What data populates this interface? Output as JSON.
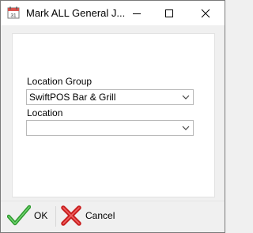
{
  "window": {
    "title": "Mark ALL General J..."
  },
  "form": {
    "location_group_label": "Location Group",
    "location_group_value": "SwiftPOS Bar & Grill",
    "location_label": "Location",
    "location_value": ""
  },
  "footer": {
    "ok_label": "OK",
    "cancel_label": "Cancel"
  },
  "colors": {
    "ok_check": "#3aa53a",
    "cancel_x": "#d62020"
  }
}
